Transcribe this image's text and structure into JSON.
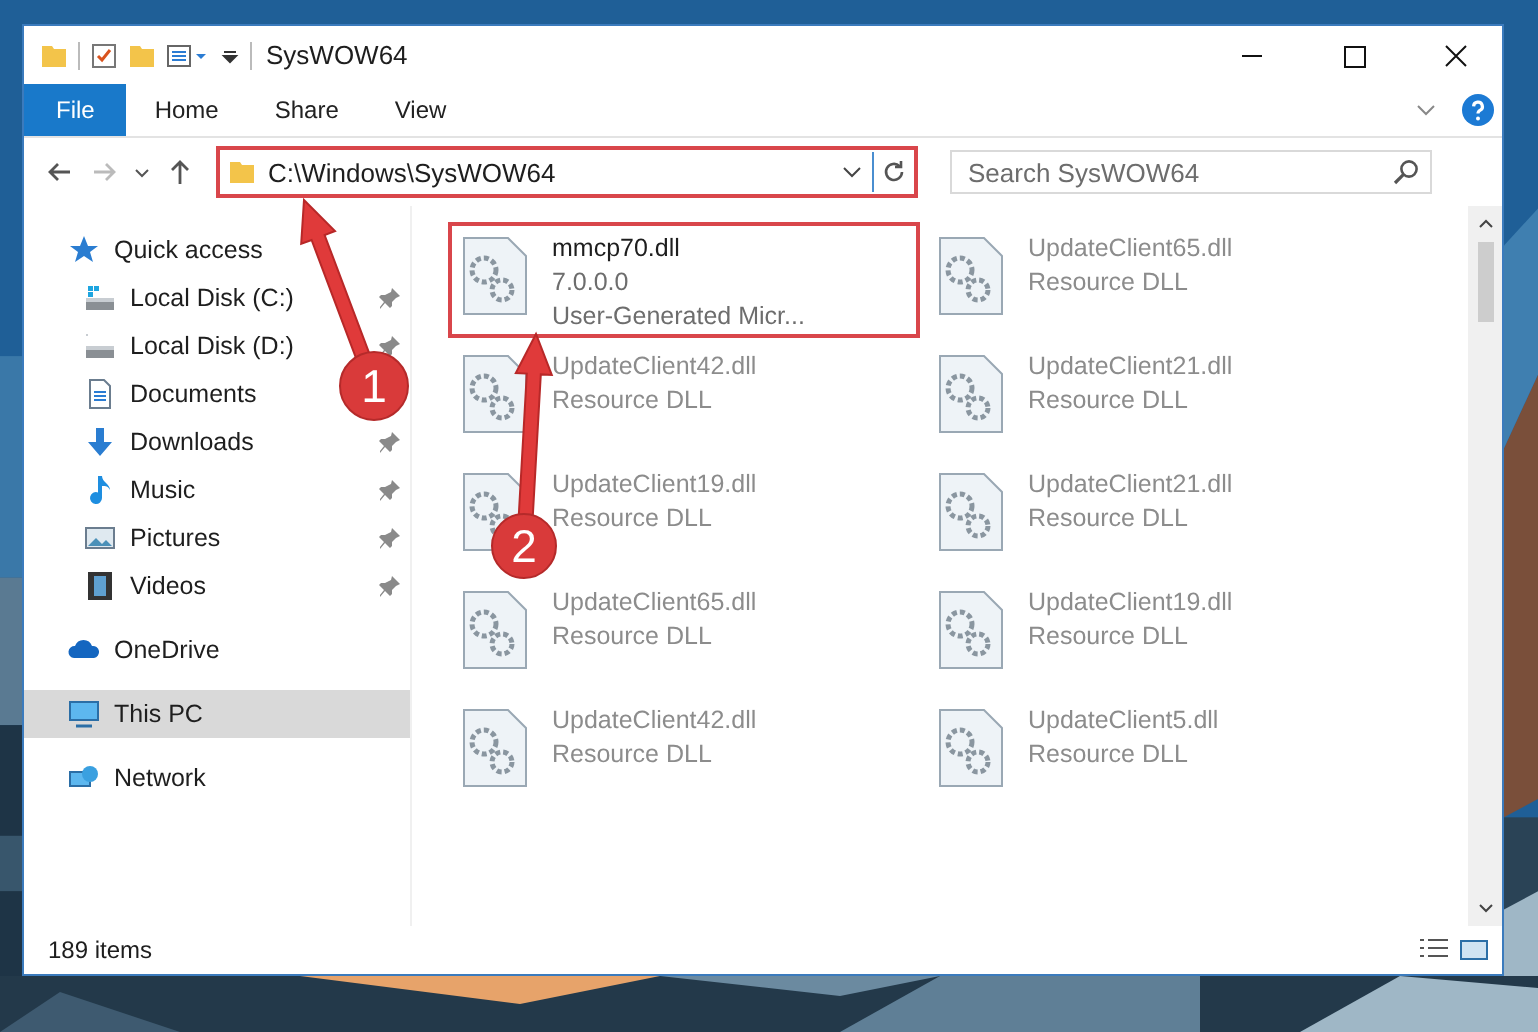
{
  "window": {
    "title": "SysWOW64"
  },
  "tabs": [
    {
      "label": "File",
      "selected": true
    },
    {
      "label": "Home",
      "selected": false
    },
    {
      "label": "Share",
      "selected": false
    },
    {
      "label": "View",
      "selected": false
    }
  ],
  "address": {
    "value": "C:\\Windows\\SysWOW64",
    "highlighted": true
  },
  "search": {
    "placeholder": "Search SysWOW64"
  },
  "sidebar": {
    "items": [
      {
        "label": "Quick access",
        "selected": false,
        "children": [
          {
            "label": "Local Disk (C:)",
            "pinned": true,
            "selected": false
          },
          {
            "label": "Local Disk (D:)",
            "pinned": true,
            "selected": false
          },
          {
            "label": "Documents",
            "pinned": false,
            "selected": false
          },
          {
            "label": "Downloads",
            "pinned": true,
            "selected": false
          },
          {
            "label": "Music",
            "pinned": true,
            "selected": false
          },
          {
            "label": "Pictures",
            "pinned": true,
            "selected": false
          },
          {
            "label": "Videos",
            "pinned": true,
            "selected": false
          }
        ]
      },
      {
        "label": "OneDrive",
        "selected": false
      },
      {
        "label": "This PC",
        "selected": true
      },
      {
        "label": "Network",
        "selected": false
      }
    ]
  },
  "files": [
    {
      "name": "mmcp70.dll",
      "lines": [
        "7.0.0.0",
        "User-Generated Micr..."
      ],
      "highlighted": true
    },
    {
      "name": "UpdateClient65.dll",
      "lines": [
        "Resource DLL"
      ],
      "highlighted": false
    },
    {
      "name": "UpdateClient42.dll",
      "lines": [
        "Resource DLL"
      ],
      "highlighted": false
    },
    {
      "name": "UpdateClient21.dll",
      "lines": [
        "Resource DLL"
      ],
      "highlighted": false
    },
    {
      "name": "UpdateClient19.dll",
      "lines": [
        "Resource DLL"
      ],
      "highlighted": false
    },
    {
      "name": "UpdateClient21.dll",
      "lines": [
        "Resource DLL"
      ],
      "highlighted": false
    },
    {
      "name": "UpdateClient65.dll",
      "lines": [
        "Resource DLL"
      ],
      "highlighted": false
    },
    {
      "name": "UpdateClient19.dll",
      "lines": [
        "Resource DLL"
      ],
      "highlighted": false
    },
    {
      "name": "UpdateClient42.dll",
      "lines": [
        "Resource DLL"
      ],
      "highlighted": false
    },
    {
      "name": "UpdateClient5.dll",
      "lines": [
        "Resource DLL"
      ],
      "highlighted": false
    }
  ],
  "status_bar": {
    "count": "189 items"
  },
  "annotations": [
    {
      "number": "1"
    },
    {
      "number": "2"
    }
  ]
}
